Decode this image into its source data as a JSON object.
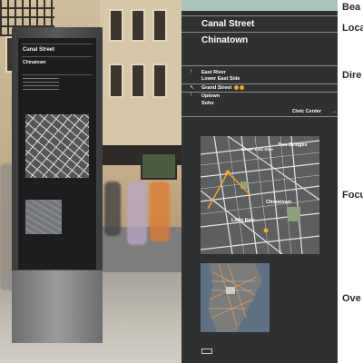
{
  "kiosk": {
    "street": "Canal Street",
    "neighborhood": "Chinatown"
  },
  "sign": {
    "street": "Canal Street",
    "neighborhood": "Chinatown",
    "directions": [
      {
        "arrow": "↑",
        "lines": [
          "East River",
          "Lower East Side"
        ],
        "badge": false
      },
      {
        "arrow": "↖",
        "lines": [
          "Grand Street"
        ],
        "badge": true
      },
      {
        "arrow": "↑",
        "lines": [
          "Uptown",
          "Soho"
        ],
        "badge": false
      }
    ],
    "civic_center": "Civic Center",
    "civic_arrow": "→",
    "map_labels": [
      "Two Bridges",
      "Lower East Side",
      "Chinatown",
      "Little Italy"
    ]
  },
  "side_labels": [
    "Bea",
    "Loca",
    "Dire",
    "Focu",
    "Ove"
  ],
  "colors": {
    "sign_bg": "#2f3031",
    "sign_band": "#a9c4bd",
    "badge": "#f5a623"
  }
}
